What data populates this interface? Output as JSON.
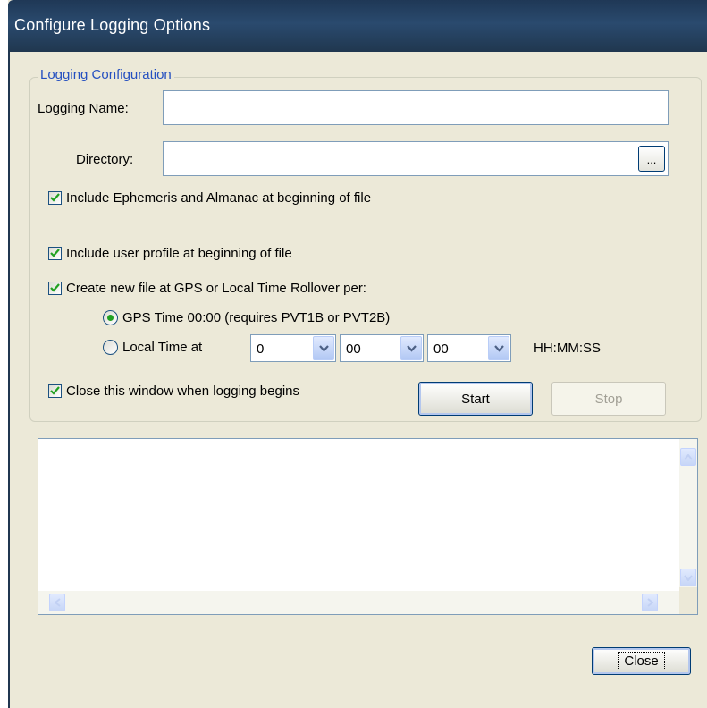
{
  "window": {
    "title": "Configure Logging Options"
  },
  "group": {
    "legend": "Logging Configuration"
  },
  "fields": {
    "logging_name_label": "Logging Name:",
    "logging_name_value": "",
    "directory_label": "Directory:",
    "directory_value": "",
    "browse_label": "..."
  },
  "checkboxes": {
    "ephemeris": {
      "label": "Include Ephemeris and Almanac at beginning of file",
      "checked": true
    },
    "user_profile": {
      "label": "Include user profile at beginning of file",
      "checked": true
    },
    "rollover": {
      "label": "Create new file at GPS or Local Time Rollover per:",
      "checked": true
    },
    "close_window": {
      "label": "Close this window when logging begins",
      "checked": true
    }
  },
  "radios": {
    "gps_time": {
      "label": "GPS Time 00:00 (requires PVT1B or PVT2B)",
      "selected": true
    },
    "local_time": {
      "label": "Local Time at",
      "selected": false
    }
  },
  "time_selects": {
    "hours": "0",
    "minutes": "00",
    "seconds": "00",
    "format": "HH:MM:SS"
  },
  "buttons": {
    "start": "Start",
    "stop": "Stop",
    "close": "Close"
  },
  "log": {
    "text": ""
  },
  "colors": {
    "titlebar": "#2a4a6e",
    "dialog": "#ece9d8",
    "legend": "#2550c0",
    "radio_dot": "#21a121"
  }
}
